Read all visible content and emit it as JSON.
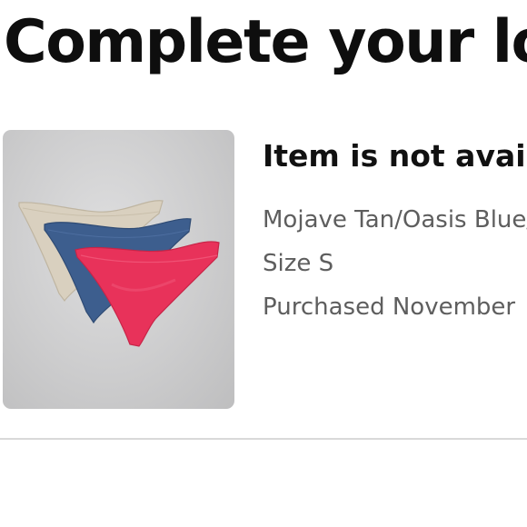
{
  "page": {
    "title": "Complete your look"
  },
  "item": {
    "status": "Item is not available",
    "color": "Mojave Tan/Oasis Blue/Pink",
    "size": "Size S",
    "purchased": "Purchased November"
  },
  "image_colors": {
    "background": "#cfcfd0",
    "tan": "#d8cfbd",
    "blue": "#3f5f8f",
    "pink": "#e8325a"
  }
}
